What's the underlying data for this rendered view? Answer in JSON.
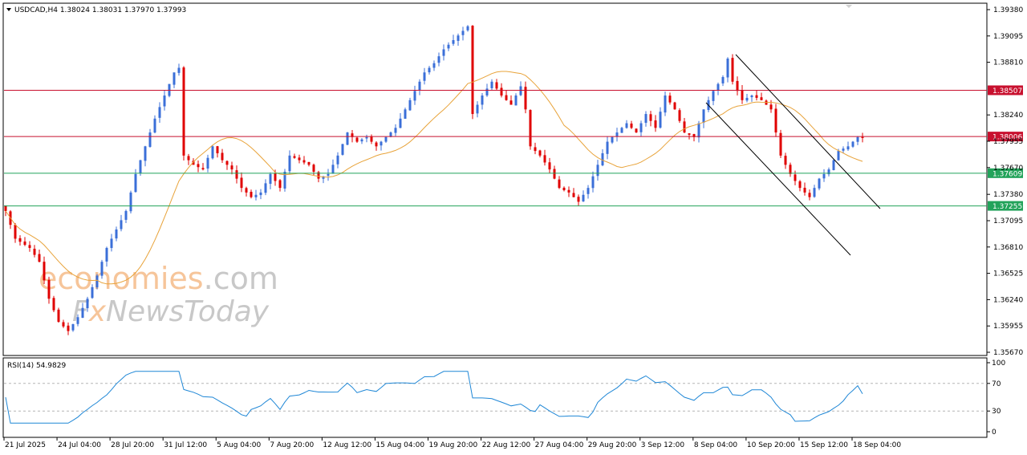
{
  "header": {
    "symbol_line": "USDCAD,H4  1.38024 1.38031 1.37970 1.37993",
    "rsi_label": "RSI(14) 54.9829"
  },
  "watermark": {
    "line1_orange": "economies",
    "line1_grey": ".com",
    "line2_a": "F",
    "line2_x": "x",
    "line2_b": "NewsToday"
  },
  "colors": {
    "bull": "#3b6fd8",
    "bear": "#e00000",
    "ma": "#e8a33a",
    "resistance": "#c8102e",
    "support": "#22a35a",
    "rsi": "#1f87d6",
    "wm_orange": "#f6c59a",
    "wm_grey": "#c8c8c8"
  },
  "chart_data": [
    {
      "type": "candlestick",
      "symbol": "USDCAD",
      "timeframe": "H4",
      "ylim": [
        1.3567,
        1.3938
      ],
      "y_ticks": [
        "1.39380",
        "1.39095",
        "1.38810",
        "1.38240",
        "1.37955",
        "1.37670",
        "1.37380",
        "1.37095",
        "1.36810",
        "1.36525",
        "1.36240",
        "1.35955",
        "1.35670"
      ],
      "x_ticks": [
        "21 Jul 2025",
        "24 Jul 04:00",
        "28 Jul 20:00",
        "31 Jul 12:00",
        "5 Aug 04:00",
        "7 Aug 20:00",
        "12 Aug 12:00",
        "15 Aug 04:00",
        "19 Aug 20:00",
        "22 Aug 12:00",
        "27 Aug 04:00",
        "29 Aug 20:00",
        "3 Sep 12:00",
        "8 Sep 04:00",
        "10 Sep 20:00",
        "15 Sep 12:00",
        "18 Sep 04:00"
      ],
      "close_path": [
        [
          0,
          1.372
        ],
        [
          2,
          1.369
        ],
        [
          5,
          1.368
        ],
        [
          7,
          1.3665
        ],
        [
          9,
          1.3625
        ],
        [
          11,
          1.36
        ],
        [
          13,
          1.359
        ],
        [
          15,
          1.3605
        ],
        [
          17,
          1.3625
        ],
        [
          19,
          1.365
        ],
        [
          21,
          1.368
        ],
        [
          23,
          1.37
        ],
        [
          25,
          1.372
        ],
        [
          27,
          1.376
        ],
        [
          29,
          1.379
        ],
        [
          31,
          1.382
        ],
        [
          33,
          1.3845
        ],
        [
          35,
          1.387
        ],
        [
          36,
          1.3875
        ],
        [
          37,
          1.378
        ],
        [
          39,
          1.377
        ],
        [
          41,
          1.3765
        ],
        [
          43,
          1.379
        ],
        [
          45,
          1.3775
        ],
        [
          47,
          1.3765
        ],
        [
          49,
          1.3745
        ],
        [
          51,
          1.3735
        ],
        [
          53,
          1.374
        ],
        [
          55,
          1.376
        ],
        [
          57,
          1.3745
        ],
        [
          59,
          1.378
        ],
        [
          61,
          1.3775
        ],
        [
          63,
          1.377
        ],
        [
          65,
          1.3755
        ],
        [
          67,
          1.376
        ],
        [
          69,
          1.378
        ],
        [
          71,
          1.3805
        ],
        [
          73,
          1.3795
        ],
        [
          75,
          1.38
        ],
        [
          77,
          1.379
        ],
        [
          79,
          1.38
        ],
        [
          81,
          1.381
        ],
        [
          83,
          1.383
        ],
        [
          85,
          1.385
        ],
        [
          87,
          1.387
        ],
        [
          89,
          1.388
        ],
        [
          91,
          1.3895
        ],
        [
          93,
          1.3905
        ],
        [
          95,
          1.3915
        ],
        [
          96,
          1.392
        ],
        [
          97,
          1.3825
        ],
        [
          99,
          1.3845
        ],
        [
          101,
          1.386
        ],
        [
          103,
          1.3845
        ],
        [
          105,
          1.3835
        ],
        [
          107,
          1.3855
        ],
        [
          108,
          1.383
        ],
        [
          109,
          1.379
        ],
        [
          111,
          1.378
        ],
        [
          113,
          1.3765
        ],
        [
          115,
          1.3745
        ],
        [
          117,
          1.374
        ],
        [
          119,
          1.373
        ],
        [
          121,
          1.3745
        ],
        [
          123,
          1.377
        ],
        [
          125,
          1.3795
        ],
        [
          127,
          1.3805
        ],
        [
          129,
          1.3815
        ],
        [
          131,
          1.3805
        ],
        [
          133,
          1.3825
        ],
        [
          135,
          1.381
        ],
        [
          137,
          1.3845
        ],
        [
          139,
          1.383
        ],
        [
          141,
          1.3805
        ],
        [
          143,
          1.38
        ],
        [
          145,
          1.383
        ],
        [
          147,
          1.385
        ],
        [
          149,
          1.3865
        ],
        [
          150,
          1.3885
        ],
        [
          151,
          1.386
        ],
        [
          153,
          1.384
        ],
        [
          155,
          1.3845
        ],
        [
          157,
          1.384
        ],
        [
          159,
          1.383
        ],
        [
          161,
          1.378
        ],
        [
          163,
          1.376
        ],
        [
          165,
          1.3745
        ],
        [
          167,
          1.3735
        ],
        [
          169,
          1.3755
        ],
        [
          171,
          1.3765
        ],
        [
          173,
          1.3785
        ],
        [
          175,
          1.379
        ],
        [
          177,
          1.38
        ],
        [
          178,
          1.3799
        ]
      ],
      "overlays": {
        "moving_average": "orange",
        "horizontal_levels": [
          {
            "value": 1.38507,
            "label": "1.38507",
            "role": "resistance"
          },
          {
            "value": 1.38006,
            "label": "1.38006",
            "role": "resistance"
          },
          {
            "value": 1.37609,
            "label": "1.37609",
            "role": "support"
          },
          {
            "value": 1.37255,
            "label": "1.37255",
            "role": "support"
          }
        ],
        "channel_lines": 2
      }
    },
    {
      "type": "line",
      "name": "RSI(14)",
      "value": 54.9829,
      "ylim": [
        0,
        100
      ],
      "y_ticks": [
        "100",
        "70",
        "30",
        "0"
      ],
      "levels": [
        70,
        30
      ]
    }
  ]
}
